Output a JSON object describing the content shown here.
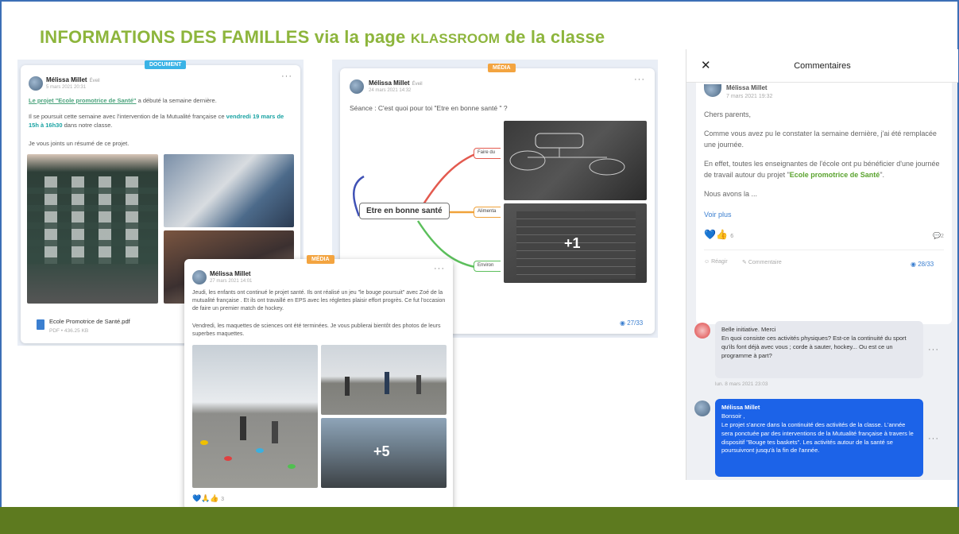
{
  "header": {
    "title_main": "INFORMATIONS DES FAMILLES via la page",
    "title_brand": "KLASSROOM",
    "title_end": "de la classe"
  },
  "post1": {
    "tag": "DOCUMENT",
    "author": "Mélissa Millet",
    "role": "Éveil",
    "date": "5 mars 2021 20:31",
    "link_text": "Le projet \"Ecole promotrice de Santé\"",
    "after_link": " a débuté la semaine dernière.",
    "p2_start": "Il se poursuit cette semaine avec l'intervention de la Mutualité française ce ",
    "p2_highlight": "vendredi 19 mars de 15h à 16h30",
    "p2_end": " dans notre classe.",
    "p3": "Je vous joints un résumé de ce projet.",
    "file_name": "Ecole Promotrice de Santé.pdf",
    "file_meta": "PDF • 436.25 KB"
  },
  "post2": {
    "tag": "MÉDIA",
    "author": "Mélissa Millet",
    "role": "Éveil",
    "date": "24 mars 2021 14:32",
    "text": "Séance : C'est quoi pour toi \"Etre en bonne santé \" ?",
    "mm_center": "Etre en bonne santé",
    "mm_node1": "Faire du",
    "mm_node2": "Alimenta",
    "mm_node3": "Environ",
    "plus_count": "+1",
    "views": "◉ 27/33"
  },
  "post3": {
    "tag": "MÉDIA",
    "author": "Mélissa Millet",
    "date": "27 mars 2021 14:01",
    "p1": "Jeudi, les enfants ont continué le projet santé. Ils ont réalisé un jeu \"le bouge poursuit\" avec Zoé de la mutualité française . Et ils ont travaillé en EPS avec les réglettes plaisir effort progrès. Ce fut l'occasion de faire un premier match de hockey.",
    "p2": "Vendredi, les maquettes de sciences ont été terminées. Je vous publierai bientôt des photos de leurs superbes maquettes.",
    "plus_count": "+5",
    "reactions": "💙🙏👍",
    "reaction_count": "3"
  },
  "comments": {
    "title": "Commentaires",
    "close": "✕",
    "author": "Mélissa Millet",
    "date": "7 mars 2021 19:32",
    "greeting": "Chers parents,",
    "p1": "Comme vous avez pu le constater la semaine dernière, j'ai été remplacée une journée.",
    "p2_start": "En effet, toutes les enseignantes de l'école ont pu bénéficier d'une journée de travail autour du projet \"",
    "p2_green": "Ecole promotrice de Santé",
    "p2_end": "\".",
    "p3": "Nous avons la ...",
    "more": "Voir plus",
    "reactions": "💙👍",
    "reaction_count": "6",
    "comment_count": "2",
    "react_label": "Réagir",
    "comment_label": "Commentaire",
    "views": "◉ 28/33",
    "c1_text": "Belle initiative. Merci\nEn quoi consiste ces activités physiques? Est-ce la continuité du sport qu'ils font déjà avec vous ; corde à sauter, hockey... Ou est ce un programme à part?",
    "c1_date": "lun. 8 mars 2021 23:03",
    "c2_author": "Mélissa Millet",
    "c2_text": "Bonsoir ,\nLe projet s'ancre dans la continuité des activités de la classe. L'année sera ponctuée par des interventions de la Mutualité française à travers le dispositif \"Bouge tes baskets\". Les activités autour de la santé se poursuivront jusqu'à la fin de l'année."
  },
  "colors": {
    "title_green": "#8db53c",
    "footer_green": "#5d7a1f",
    "tag_blue": "#3ab3e6",
    "tag_orange": "#f3a440",
    "bubble_blue": "#1c63e8"
  }
}
